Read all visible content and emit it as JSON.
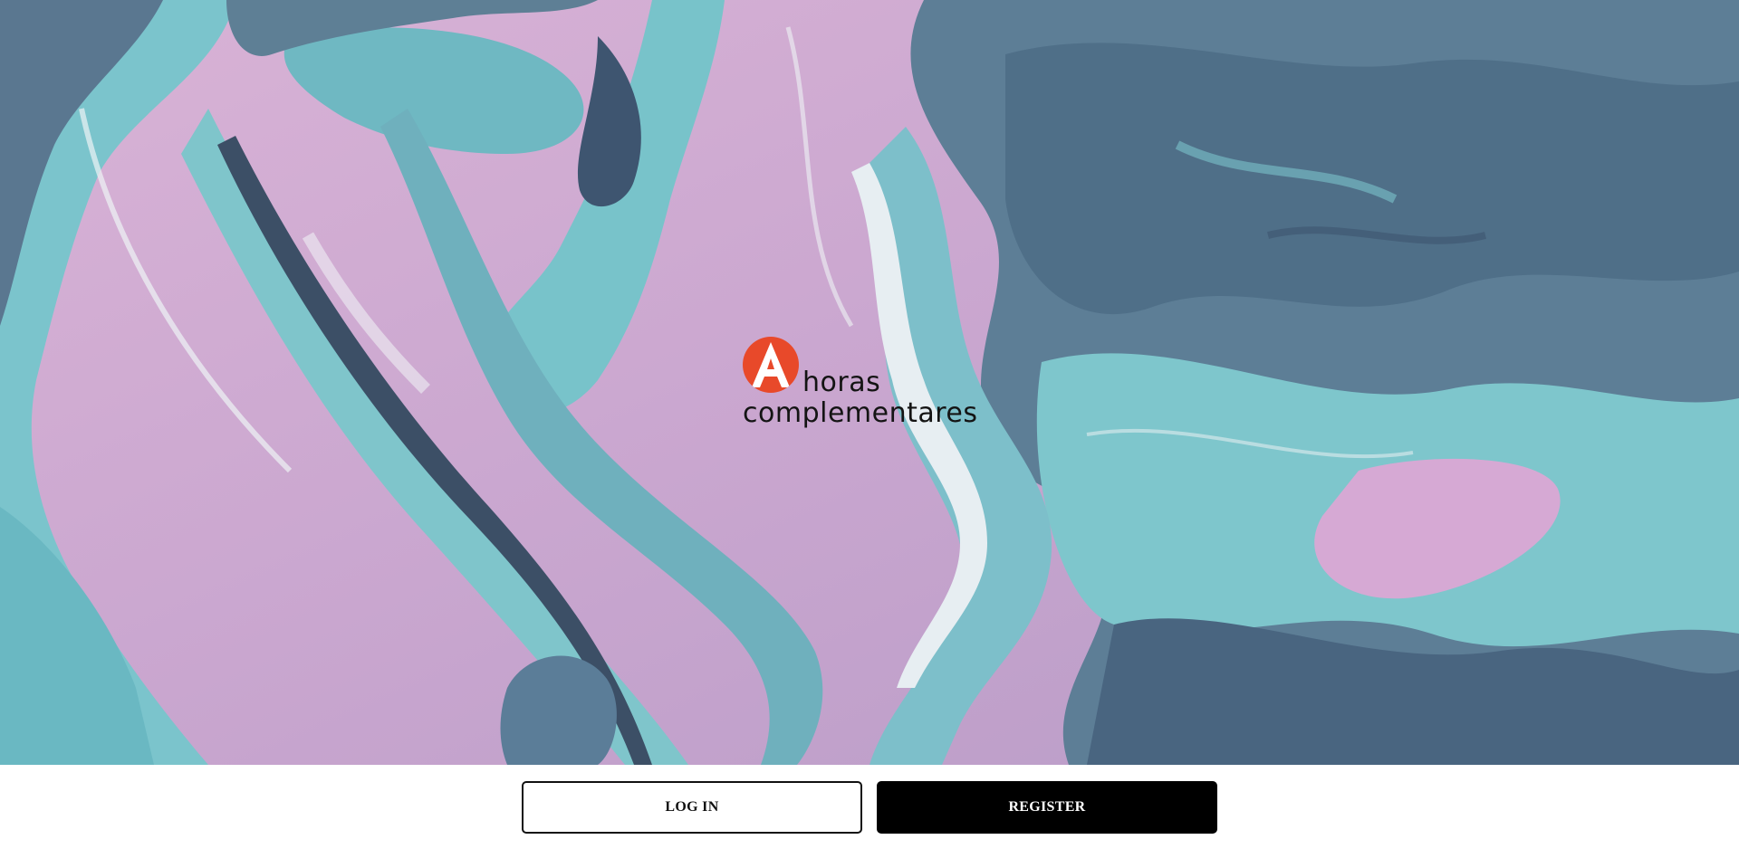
{
  "hero": {
    "background_icon": "abstract-paint-marble-image",
    "colors": {
      "pink": "#d6b1d6",
      "teal": "#7ec8cf",
      "slate": "#5e7f95",
      "deep": "#3b4f66"
    }
  },
  "logo": {
    "mark_letter": "A",
    "word_line_1": "horas",
    "word_line_2": "complementares",
    "accent_color": "#e8492a"
  },
  "actions": {
    "login_label": "LOG IN",
    "register_label": "REGISTER"
  }
}
